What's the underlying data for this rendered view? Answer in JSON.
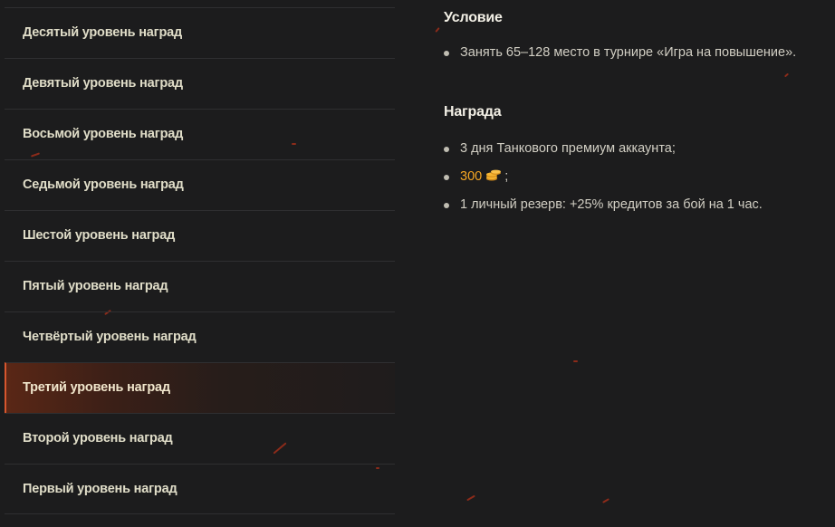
{
  "sidebar": {
    "items": [
      {
        "label": "Десятый уровень наград"
      },
      {
        "label": "Девятый уровень наград"
      },
      {
        "label": "Восьмой уровень наград"
      },
      {
        "label": "Седьмой уровень наград"
      },
      {
        "label": "Шестой уровень наград"
      },
      {
        "label": "Пятый уровень наград"
      },
      {
        "label": "Четвёртый уровень наград"
      },
      {
        "label": "Третий уровень наград"
      },
      {
        "label": "Второй уровень наград"
      },
      {
        "label": "Первый уровень наград"
      }
    ],
    "selected_label": "Третий уровень наград"
  },
  "condition": {
    "title": "Условие",
    "items": [
      "Занять 65–128 место в турнире «Игра на повышение»."
    ]
  },
  "reward": {
    "title": "Награда",
    "item_premium": "3 дня Танкового премиум аккаунта;",
    "gold_amount": "300",
    "gold_suffix": ";",
    "item_reserve": "1 личный резерв: +25% кредитов за бой на 1 час."
  },
  "colors": {
    "background": "#1c1c1d",
    "active_accent": "#d6562e",
    "gold": "#f5a623",
    "spark": "#b2301a"
  },
  "icons": {
    "gold": "gold-coins-icon",
    "bullet": "bullet-dot-icon"
  }
}
